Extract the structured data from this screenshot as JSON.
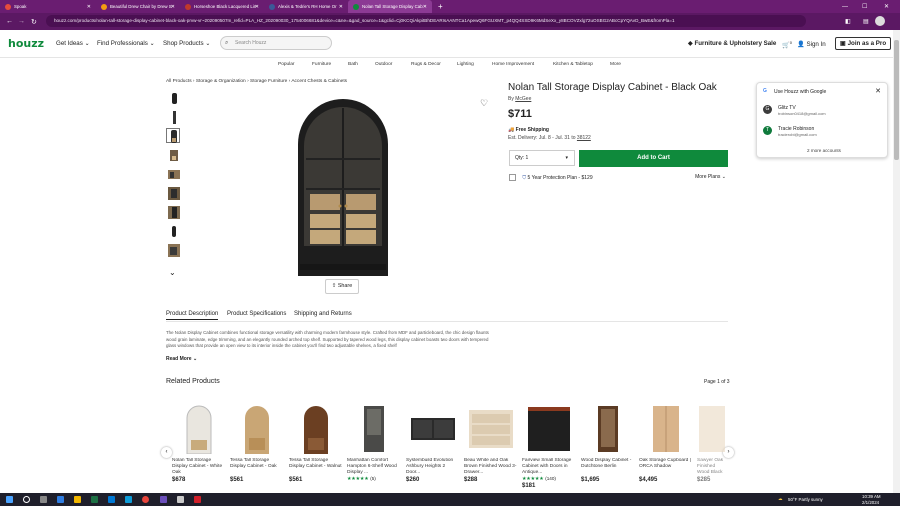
{
  "browser": {
    "tabs": [
      {
        "title": "Spoak",
        "color": "#e74c3c"
      },
      {
        "title": "Beautiful Drew Chair by Drew S",
        "color": "#f39c12"
      },
      {
        "title": "Horseshoe Black Lacquered Lin",
        "color": "#c0392b"
      },
      {
        "title": "Alexis & Tedrie's RH Home Or",
        "color": "#3b5998"
      },
      {
        "title": "Nolan Tall Storage Display Cab",
        "color": "#0f8a3c"
      }
    ],
    "new_tab": "+",
    "url": "houzz.com/products/nolan-tall-storage-display-cabinet-black-oak-prvw-vr~202090507m_refid=PLA_HZ_202090030_1754006681&device=c&ne=&gad_source=1&gclid=Cj0KCQiAkpitBhDEARIsAANTCa1ApewQ6FGUXMT_p4QQ4SSD9K6MdSeXx_y8BCOVZxlg72uOSBG2ABcCpYQAvD_BwE&fromPla=1"
  },
  "nav": {
    "logo": "houzz",
    "get_ideas": "Get Ideas",
    "find_professionals": "Find Professionals",
    "shop_products": "Shop Products",
    "search_placeholder": "Search Houzz",
    "sale_banner": "Furniture & Upholstery Sale",
    "cart_count": "0",
    "sign_in": "Sign In",
    "join_pro": "Join as a Pro"
  },
  "categories": [
    "Popular",
    "Furniture",
    "Bath",
    "Outdoor",
    "Rugs & Decor",
    "Lighting",
    "Home Improvement",
    "Kitchen & Tabletop",
    "More"
  ],
  "breadcrumb": [
    "All Products",
    "Storage & Organization",
    "Storage Furniture",
    "Accent Chests & Cabinets"
  ],
  "product": {
    "title": "Nolan Tall Storage Display Cabinet - Black Oak",
    "by_label": "By",
    "brand": "McGee",
    "price": "$711",
    "shipping": "Free Shipping",
    "delivery_label": "Est. Delivery: Jul. 8 - Jul. 31 to",
    "delivery_zip": "38122",
    "qty_label": "Qty: 1",
    "add_to_cart": "Add to Cart",
    "protection": "5 Year Protection Plan - $129",
    "more_plans": "More Plans",
    "share": "Share"
  },
  "google_popup": {
    "title": "Use Houzz with Google",
    "accounts": [
      {
        "initial": "G",
        "name": "Glitz TV",
        "email": "trobinson0418@gmail.com",
        "color": "#3c3c3c"
      },
      {
        "initial": "T",
        "name": "Tracie Robinson",
        "email": "tracierobi@gmail.com",
        "color": "#0f7a3c"
      }
    ],
    "more": "2 more accounts"
  },
  "detail_tabs": [
    "Product Description",
    "Product Specifications",
    "Shipping and Returns"
  ],
  "description": "The Nolan Display Cabinet combines functional storage versatility with charming modern farmhouse style. Crafted from MDF and particleboard, the chic design flaunts wood grain laminate, edge trimming, and an elegantly rounded arched top shelf. Supported by tapered wood legs, this display cabinet boasts two doors with tempered glass windows that provide an open view to its interior inside the cabinet you'll find two adjustable shelves, a fixed shelf",
  "read_more": "Read More",
  "related": {
    "heading": "Related Products",
    "page": "Page 1 of 3",
    "items": [
      {
        "name": "Nolan Tall Storage Display Cabinet - White Oak",
        "price": "$678",
        "stars": "",
        "reviews": ""
      },
      {
        "name": "Tessa Tall Storage Display Cabinet - Oak",
        "price": "$561",
        "stars": "",
        "reviews": ""
      },
      {
        "name": "Tessa Tall Storage Display Cabinet - Walnut",
        "price": "$561",
        "stars": "",
        "reviews": ""
      },
      {
        "name": "Manhattan Comfort Hampton 6-Shelf Wood Display ...",
        "price": "",
        "stars": "★★★★★",
        "reviews": "(5)"
      },
      {
        "name": "Systembuild Evolution Ashbury Heights 2 Door...",
        "price": "$260",
        "stars": "",
        "reviews": ""
      },
      {
        "name": "Beau White and Oak Brown Finished Wood 3-Drawer...",
        "price": "$288",
        "stars": "",
        "reviews": ""
      },
      {
        "name": "Fairview Small Storage Cabinet with Doors in Antique...",
        "price": "$181",
        "stars": "★★★★★",
        "reviews": "(140)"
      },
      {
        "name": "Wood Display Cabinet - Dutchtone Berlin",
        "price": "$1,695",
        "stars": "",
        "reviews": ""
      },
      {
        "name": "Oak Storage Cupboard | ORCA Shadow",
        "price": "$4,495",
        "stars": "",
        "reviews": ""
      },
      {
        "name": "Sawyer Oak Finished Wood Black Metal",
        "price": "$285",
        "stars": "",
        "reviews": ""
      }
    ]
  },
  "taskbar": {
    "weather": "50°F  Partly sunny",
    "time": "10:39 AM",
    "date": "2/1/2024"
  }
}
